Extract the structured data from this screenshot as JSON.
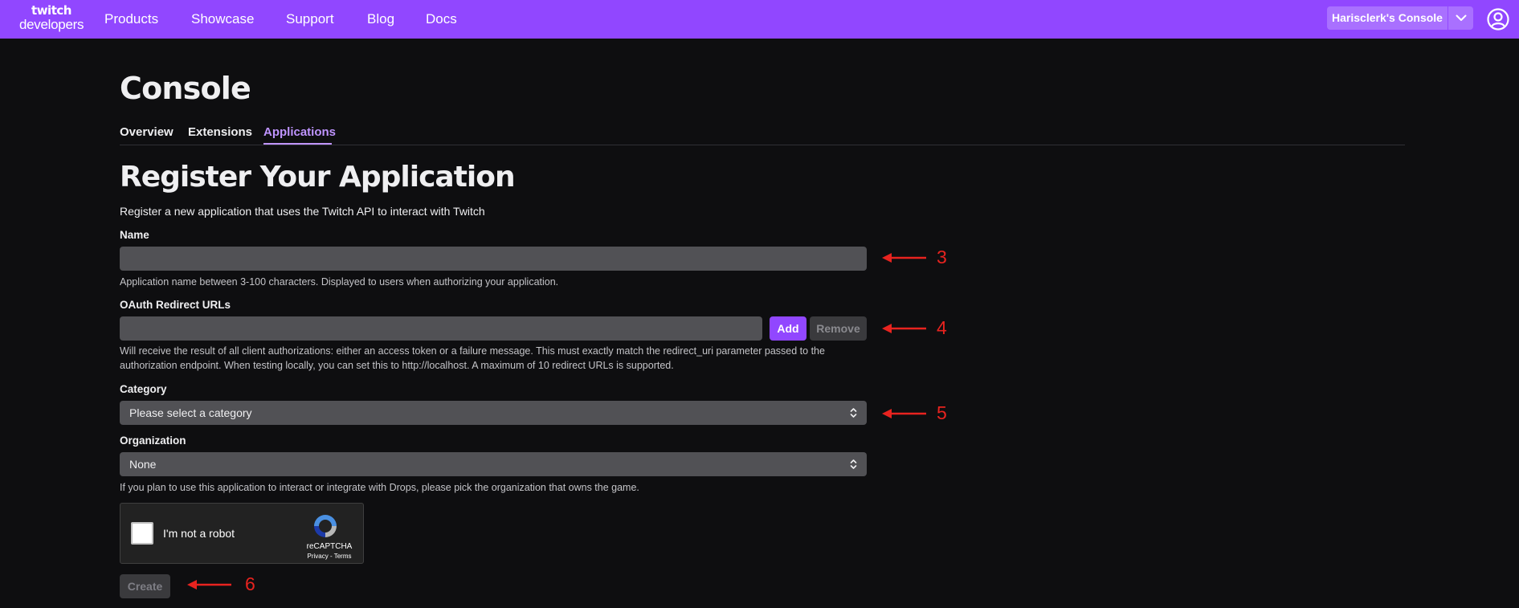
{
  "nav": {
    "logo_line1": "twitch",
    "logo_line2": "developers",
    "links": [
      "Products",
      "Showcase",
      "Support",
      "Blog",
      "Docs"
    ],
    "console_button": "Harisclerk's Console"
  },
  "console": {
    "title": "Console",
    "tabs": [
      "Overview",
      "Extensions",
      "Applications"
    ],
    "active_tab": "Applications"
  },
  "form": {
    "title": "Register Your Application",
    "subtitle": "Register a new application that uses the Twitch API to interact with Twitch",
    "name": {
      "label": "Name",
      "value": "",
      "help": "Application name between 3-100 characters. Displayed to users when authorizing your application."
    },
    "oauth": {
      "label": "OAuth Redirect URLs",
      "value": "",
      "add_label": "Add",
      "remove_label": "Remove",
      "help": "Will receive the result of all client authorizations: either an access token or a failure message. This must exactly match the redirect_uri parameter passed to the authorization endpoint. When testing locally, you can set this to http://localhost. A maximum of 10 redirect URLs is supported."
    },
    "category": {
      "label": "Category",
      "selected": "Please select a category"
    },
    "organization": {
      "label": "Organization",
      "selected": "None",
      "help": "If you plan to use this application to interact or integrate with Drops, please pick the organization that owns the game."
    },
    "captcha": {
      "label": "I'm not a robot",
      "brand": "reCAPTCHA",
      "links": "Privacy - Terms"
    },
    "create_label": "Create"
  },
  "annotations": [
    "3",
    "4",
    "5",
    "6"
  ],
  "colors": {
    "brand": "#9147ff",
    "accent": "#bf94ff",
    "background": "#0e0e10",
    "annotation": "#e8231f"
  }
}
